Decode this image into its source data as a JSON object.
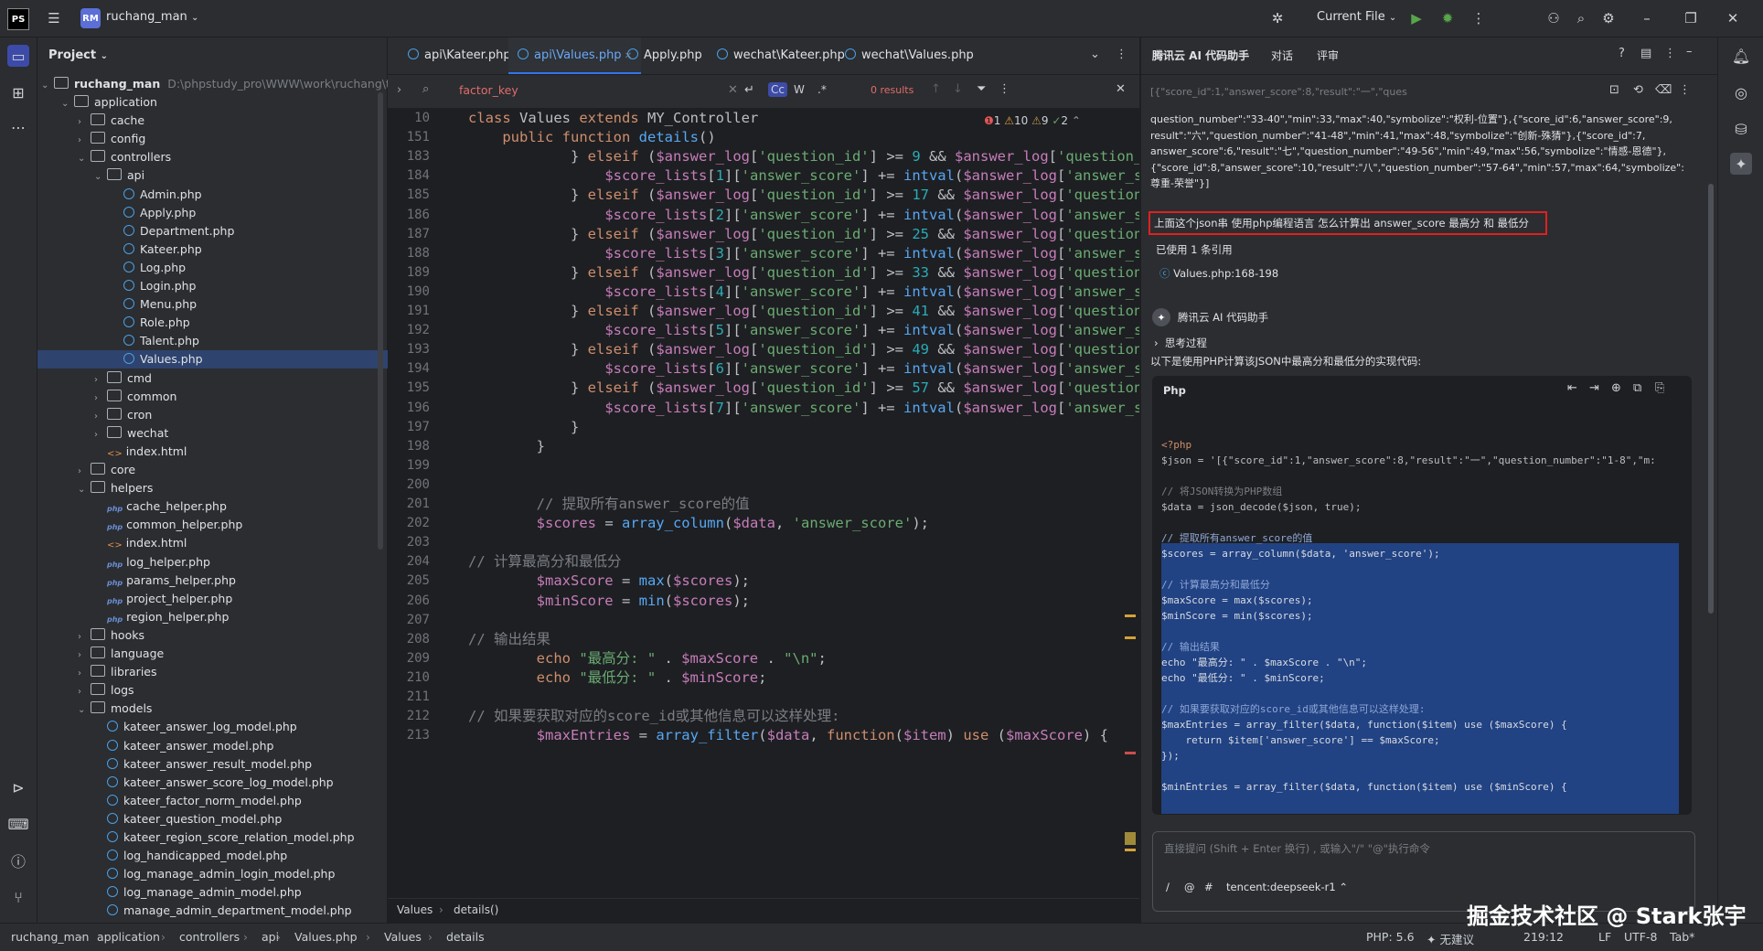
{
  "titlebar": {
    "ide_logo": "PS",
    "project_badge": "RM",
    "project_name": "ruchang_man",
    "run_config": "Current File"
  },
  "project_panel": {
    "title": "Project",
    "root_name": "ruchang_man",
    "root_path": "D:\\phpstudy_pro\\WWW\\work\\ruchang\\test",
    "tree": [
      {
        "label": "application",
        "type": "folder",
        "depth": 1,
        "open": true
      },
      {
        "label": "cache",
        "type": "folder",
        "depth": 2
      },
      {
        "label": "config",
        "type": "folder",
        "depth": 2
      },
      {
        "label": "controllers",
        "type": "folder",
        "depth": 2,
        "open": true
      },
      {
        "label": "api",
        "type": "folder",
        "depth": 3,
        "open": true
      },
      {
        "label": "Admin.php",
        "type": "class",
        "depth": 4
      },
      {
        "label": "Apply.php",
        "type": "class",
        "depth": 4
      },
      {
        "label": "Department.php",
        "type": "class",
        "depth": 4
      },
      {
        "label": "Kateer.php",
        "type": "class",
        "depth": 4
      },
      {
        "label": "Log.php",
        "type": "class",
        "depth": 4
      },
      {
        "label": "Login.php",
        "type": "class",
        "depth": 4
      },
      {
        "label": "Menu.php",
        "type": "class",
        "depth": 4
      },
      {
        "label": "Role.php",
        "type": "class",
        "depth": 4
      },
      {
        "label": "Talent.php",
        "type": "class",
        "depth": 4
      },
      {
        "label": "Values.php",
        "type": "class",
        "depth": 4,
        "selected": true
      },
      {
        "label": "cmd",
        "type": "folder",
        "depth": 3
      },
      {
        "label": "common",
        "type": "folder",
        "depth": 3
      },
      {
        "label": "cron",
        "type": "folder",
        "depth": 3
      },
      {
        "label": "wechat",
        "type": "folder",
        "depth": 3
      },
      {
        "label": "index.html",
        "type": "html",
        "depth": 3
      },
      {
        "label": "core",
        "type": "folder",
        "depth": 2
      },
      {
        "label": "helpers",
        "type": "folder",
        "depth": 2,
        "open": true
      },
      {
        "label": "cache_helper.php",
        "type": "php",
        "depth": 3
      },
      {
        "label": "common_helper.php",
        "type": "php",
        "depth": 3
      },
      {
        "label": "index.html",
        "type": "html",
        "depth": 3
      },
      {
        "label": "log_helper.php",
        "type": "php",
        "depth": 3
      },
      {
        "label": "params_helper.php",
        "type": "php",
        "depth": 3
      },
      {
        "label": "project_helper.php",
        "type": "php",
        "depth": 3
      },
      {
        "label": "region_helper.php",
        "type": "php",
        "depth": 3
      },
      {
        "label": "hooks",
        "type": "folder",
        "depth": 2
      },
      {
        "label": "language",
        "type": "folder",
        "depth": 2
      },
      {
        "label": "libraries",
        "type": "folder",
        "depth": 2
      },
      {
        "label": "logs",
        "type": "folder",
        "depth": 2
      },
      {
        "label": "models",
        "type": "folder",
        "depth": 2,
        "open": true
      },
      {
        "label": "kateer_answer_log_model.php",
        "type": "class",
        "depth": 3
      },
      {
        "label": "kateer_answer_model.php",
        "type": "class",
        "depth": 3
      },
      {
        "label": "kateer_answer_result_model.php",
        "type": "class",
        "depth": 3
      },
      {
        "label": "kateer_answer_score_log_model.php",
        "type": "class",
        "depth": 3
      },
      {
        "label": "kateer_factor_norm_model.php",
        "type": "class",
        "depth": 3
      },
      {
        "label": "kateer_question_model.php",
        "type": "class",
        "depth": 3
      },
      {
        "label": "kateer_region_score_relation_model.php",
        "type": "class",
        "depth": 3
      },
      {
        "label": "log_handicapped_model.php",
        "type": "class",
        "depth": 3
      },
      {
        "label": "log_manage_admin_login_model.php",
        "type": "class",
        "depth": 3
      },
      {
        "label": "log_manage_admin_model.php",
        "type": "class",
        "depth": 3
      },
      {
        "label": "manage_admin_department_model.php",
        "type": "class",
        "depth": 3
      }
    ]
  },
  "editor": {
    "tabs": [
      {
        "label": "api\\Kateer.php",
        "active": false
      },
      {
        "label": "api\\Values.php",
        "active": true
      },
      {
        "label": "Apply.php",
        "active": false
      },
      {
        "label": "wechat\\Kateer.php",
        "active": false
      },
      {
        "label": "wechat\\Values.php",
        "active": false
      }
    ],
    "search_query": "factor_key",
    "search_results": "0 results",
    "search_opts": [
      "Cc",
      "W",
      ".*"
    ],
    "inspections": {
      "errors": "1",
      "warnings": "10",
      "weak": "9",
      "ok": "2"
    },
    "breadcrumb": [
      "Values",
      "details()"
    ],
    "lines": [
      {
        "n": "10",
        "html": "<span class='kw'>class</span> Values <span class='kw'>extends</span> MY_Controller"
      },
      {
        "n": "151",
        "html": "    <span class='kw'>public function</span> <span class='fn'>details</span>()"
      },
      {
        "n": "183",
        "html": "            } <span class='kw'>elseif</span> (<span class='var'>$answer_log</span>[<span class='str'>'question_id'</span>] >= <span class='num'>9</span> && <span class='var'>$answer_log</span>[<span class='str'>'question_id'</span>"
      },
      {
        "n": "184",
        "html": "                <span class='var'>$score_lists</span>[<span class='num'>1</span>][<span class='str'>'answer_score'</span>] += <span class='fn'>intval</span>(<span class='var'>$answer_log</span>[<span class='str'>'answer_scor</span>"
      },
      {
        "n": "185",
        "html": "            } <span class='kw'>elseif</span> (<span class='var'>$answer_log</span>[<span class='str'>'question_id'</span>] >= <span class='num'>17</span> && <span class='var'>$answer_log</span>[<span class='str'>'question_ic</span>"
      },
      {
        "n": "186",
        "html": "                <span class='var'>$score_lists</span>[<span class='num'>2</span>][<span class='str'>'answer_score'</span>] += <span class='fn'>intval</span>(<span class='var'>$answer_log</span>[<span class='str'>'answer_scor</span>"
      },
      {
        "n": "187",
        "html": "            } <span class='kw'>elseif</span> (<span class='var'>$answer_log</span>[<span class='str'>'question_id'</span>] >= <span class='num'>25</span> && <span class='var'>$answer_log</span>[<span class='str'>'question_ic</span>"
      },
      {
        "n": "188",
        "html": "                <span class='var'>$score_lists</span>[<span class='num'>3</span>][<span class='str'>'answer_score'</span>] += <span class='fn'>intval</span>(<span class='var'>$answer_log</span>[<span class='str'>'answer_scor</span>"
      },
      {
        "n": "189",
        "html": "            } <span class='kw'>elseif</span> (<span class='var'>$answer_log</span>[<span class='str'>'question_id'</span>] >= <span class='num'>33</span> && <span class='var'>$answer_log</span>[<span class='str'>'question_ic</span>"
      },
      {
        "n": "190",
        "html": "                <span class='var'>$score_lists</span>[<span class='num'>4</span>][<span class='str'>'answer_score'</span>] += <span class='fn'>intval</span>(<span class='var'>$answer_log</span>[<span class='str'>'answer_scor</span>"
      },
      {
        "n": "191",
        "html": "            } <span class='kw'>elseif</span> (<span class='var'>$answer_log</span>[<span class='str'>'question_id'</span>] >= <span class='num'>41</span> && <span class='var'>$answer_log</span>[<span class='str'>'question_ic</span>"
      },
      {
        "n": "192",
        "html": "                <span class='var'>$score_lists</span>[<span class='num'>5</span>][<span class='str'>'answer_score'</span>] += <span class='fn'>intval</span>(<span class='var'>$answer_log</span>[<span class='str'>'answer_scor</span>"
      },
      {
        "n": "193",
        "html": "            } <span class='kw'>elseif</span> (<span class='var'>$answer_log</span>[<span class='str'>'question_id'</span>] >= <span class='num'>49</span> && <span class='var'>$answer_log</span>[<span class='str'>'question_ic</span>"
      },
      {
        "n": "194",
        "html": "                <span class='var'>$score_lists</span>[<span class='num'>6</span>][<span class='str'>'answer_score'</span>] += <span class='fn'>intval</span>(<span class='var'>$answer_log</span>[<span class='str'>'answer_scor</span>"
      },
      {
        "n": "195",
        "html": "            } <span class='kw'>elseif</span> (<span class='var'>$answer_log</span>[<span class='str'>'question_id'</span>] >= <span class='num'>57</span> && <span class='var'>$answer_log</span>[<span class='str'>'question_ic</span>"
      },
      {
        "n": "196",
        "html": "                <span class='var'>$score_lists</span>[<span class='num'>7</span>][<span class='str'>'answer_score'</span>] += <span class='fn'>intval</span>(<span class='var'>$answer_log</span>[<span class='str'>'answer_scor</span>"
      },
      {
        "n": "197",
        "html": "            }"
      },
      {
        "n": "198",
        "html": "        }"
      },
      {
        "n": "199",
        "html": ""
      },
      {
        "n": "200",
        "html": ""
      },
      {
        "n": "201",
        "html": "        <span class='cm'>// 提取所有answer_score的值</span>"
      },
      {
        "n": "202",
        "html": "        <span class='var'>$scores</span> = <span class='fn'>array_column</span>(<span class='var'>$data</span>, <span class='str'>'answer_score'</span>);"
      },
      {
        "n": "203",
        "html": ""
      },
      {
        "n": "204",
        "html": "<span class='cm'>// 计算最高分和最低分</span>"
      },
      {
        "n": "205",
        "html": "        <span class='var'>$maxScore</span> = <span class='fn'>max</span>(<span class='var'>$scores</span>);"
      },
      {
        "n": "206",
        "html": "        <span class='var'>$minScore</span> = <span class='fn'>min</span>(<span class='var'>$scores</span>);"
      },
      {
        "n": "207",
        "html": ""
      },
      {
        "n": "208",
        "html": "<span class='cm'>// 输出结果</span>"
      },
      {
        "n": "209",
        "html": "        <span class='kw'>echo</span> <span class='str'>\"最高分: \"</span> . <span class='var'>$maxScore</span> . <span class='str'>\"\\n\"</span>;"
      },
      {
        "n": "210",
        "html": "        <span class='kw'>echo</span> <span class='str'>\"最低分: \"</span> . <span class='var'>$minScore</span>;"
      },
      {
        "n": "211",
        "html": ""
      },
      {
        "n": "212",
        "html": "<span class='cm'>// 如果要获取对应的score_id或其他信息可以这样处理:</span>"
      },
      {
        "n": "213",
        "html": "        <span class='var'>$maxEntries</span> = <span class='fn'>array_filter</span>(<span class='var'>$data</span>, <span class='kw'>function</span>(<span class='var'>$item</span>) <span class='kw'>use</span> (<span class='var'>$maxScore</span>) {"
      }
    ]
  },
  "ai_panel": {
    "title": "腾讯云 AI 代码助手",
    "tab_chat": "对话",
    "tab_review": "评审",
    "json_preview": "[{\"score_id\":1,\"answer_score\":8,\"result\":\"一\",\"ques",
    "json_lines": [
      "question_number\":\"33-40\",\"min\":33,\"max\":40,\"symbolize\":\"权利-位置\"},{\"score_id\":6,\"answer_score\":9,",
      "result\":\"六\",\"question_number\":\"41-48\",\"min\":41,\"max\":48,\"symbolize\":\"创新-殊猜\"},{\"score_id\":7,",
      "answer_score\":6,\"result\":\"七\",\"question_number\":\"49-56\",\"min\":49,\"max\":56,\"symbolize\":\"情感-恩德\"},",
      "{\"score_id\":8,\"answer_score\":10,\"result\":\"八\",\"question_number\":\"57-64\",\"min\":57,\"max\":64,\"symbolize\":",
      "尊重-荣誉\"}]"
    ],
    "question": "上面这个json串 使用php编程语言 怎么计算出 answer_score 最高分 和 最低分",
    "used_refs": "已使用 1 条引用",
    "ref_file": "Values.php:168-198",
    "assistant_name": "腾讯云 AI 代码助手",
    "thinking": "思考过程",
    "intro": "以下是使用PHP计算该JSON中最高分和最低分的实现代码:",
    "code_lang": "Php",
    "code_lines": [
      {
        "t": "<?php",
        "c": "#cf8e6d"
      },
      {
        "t": "$json = '[{\"score_id\":1,\"answer_score\":8,\"result\":\"一\",\"question_number\":\"1-8\",\"m:",
        "c": "#bcbec4"
      },
      {
        "t": "",
        "c": "#bcbec4"
      },
      {
        "t": "// 将JSON转换为PHP数组",
        "c": "#7a7e85"
      },
      {
        "t": "$data = json_decode($json, true);",
        "c": "#bcbec4"
      },
      {
        "t": "",
        "c": "#bcbec4"
      },
      {
        "t": "// 提取所有answer_score的值",
        "c": "#8fa7d6"
      },
      {
        "t": "$scores = array_column($data, 'answer_score');",
        "c": "#d8dce2"
      },
      {
        "t": "",
        "c": "#bcbec4"
      },
      {
        "t": "// 计算最高分和最低分",
        "c": "#8fa7d6"
      },
      {
        "t": "$maxScore = max($scores);",
        "c": "#d8dce2"
      },
      {
        "t": "$minScore = min($scores);",
        "c": "#d8dce2"
      },
      {
        "t": "",
        "c": "#bcbec4"
      },
      {
        "t": "// 输出结果",
        "c": "#8fa7d6"
      },
      {
        "t": "echo \"最高分: \" . $maxScore . \"\\n\";",
        "c": "#d8dce2"
      },
      {
        "t": "echo \"最低分: \" . $minScore;",
        "c": "#d8dce2"
      },
      {
        "t": "",
        "c": "#bcbec4"
      },
      {
        "t": "// 如果要获取对应的score_id或其他信息可以这样处理:",
        "c": "#8fa7d6"
      },
      {
        "t": "$maxEntries = array_filter($data, function($item) use ($maxScore) {",
        "c": "#d8dce2"
      },
      {
        "t": "    return $item['answer_score'] == $maxScore;",
        "c": "#d8dce2"
      },
      {
        "t": "});",
        "c": "#d8dce2"
      },
      {
        "t": "",
        "c": "#bcbec4"
      },
      {
        "t": "$minEntries = array_filter($data, function($item) use ($minScore) {",
        "c": "#d8dce2"
      }
    ],
    "input_placeholder": "直接提问 (Shift + Enter 换行) , 或输入\"/\" \"@\"执行命令",
    "model": "tencent:deepseek-r1"
  },
  "statusbar": {
    "breadcrumb": [
      "ruchang_man",
      "application",
      "controllers",
      "api",
      "Values.php",
      "Values",
      "details"
    ],
    "php_version": "PHP: 5.6",
    "suggestion": "无建议",
    "position": "219:12",
    "line_sep": "LF",
    "encoding": "UTF-8",
    "indent": "Tab*"
  },
  "watermark": "掘金技术社区 @ Stark张宇",
  "colors": {
    "accent": "#3574f0",
    "highlight": "#e02020"
  }
}
